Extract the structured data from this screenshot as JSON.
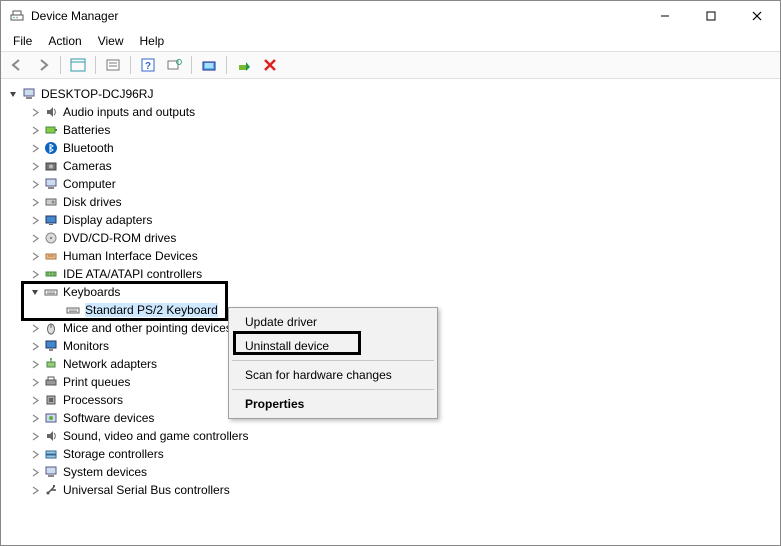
{
  "window": {
    "title": "Device Manager",
    "min": "–",
    "max": "▢",
    "close": "✕"
  },
  "menus": [
    "File",
    "Action",
    "View",
    "Help"
  ],
  "tree": {
    "root": "DESKTOP-DCJ96RJ",
    "categories": [
      "Audio inputs and outputs",
      "Batteries",
      "Bluetooth",
      "Cameras",
      "Computer",
      "Disk drives",
      "Display adapters",
      "DVD/CD-ROM drives",
      "Human Interface Devices",
      "IDE ATA/ATAPI controllers",
      "Keyboards",
      "Mice and other pointing devices",
      "Monitors",
      "Network adapters",
      "Print queues",
      "Processors",
      "Software devices",
      "Sound, video and game controllers",
      "Storage controllers",
      "System devices",
      "Universal Serial Bus controllers"
    ],
    "keyboards_child": "Standard PS/2 Keyboard"
  },
  "context_menu": {
    "update": "Update driver",
    "uninstall": "Uninstall device",
    "scan": "Scan for hardware changes",
    "properties": "Properties"
  }
}
